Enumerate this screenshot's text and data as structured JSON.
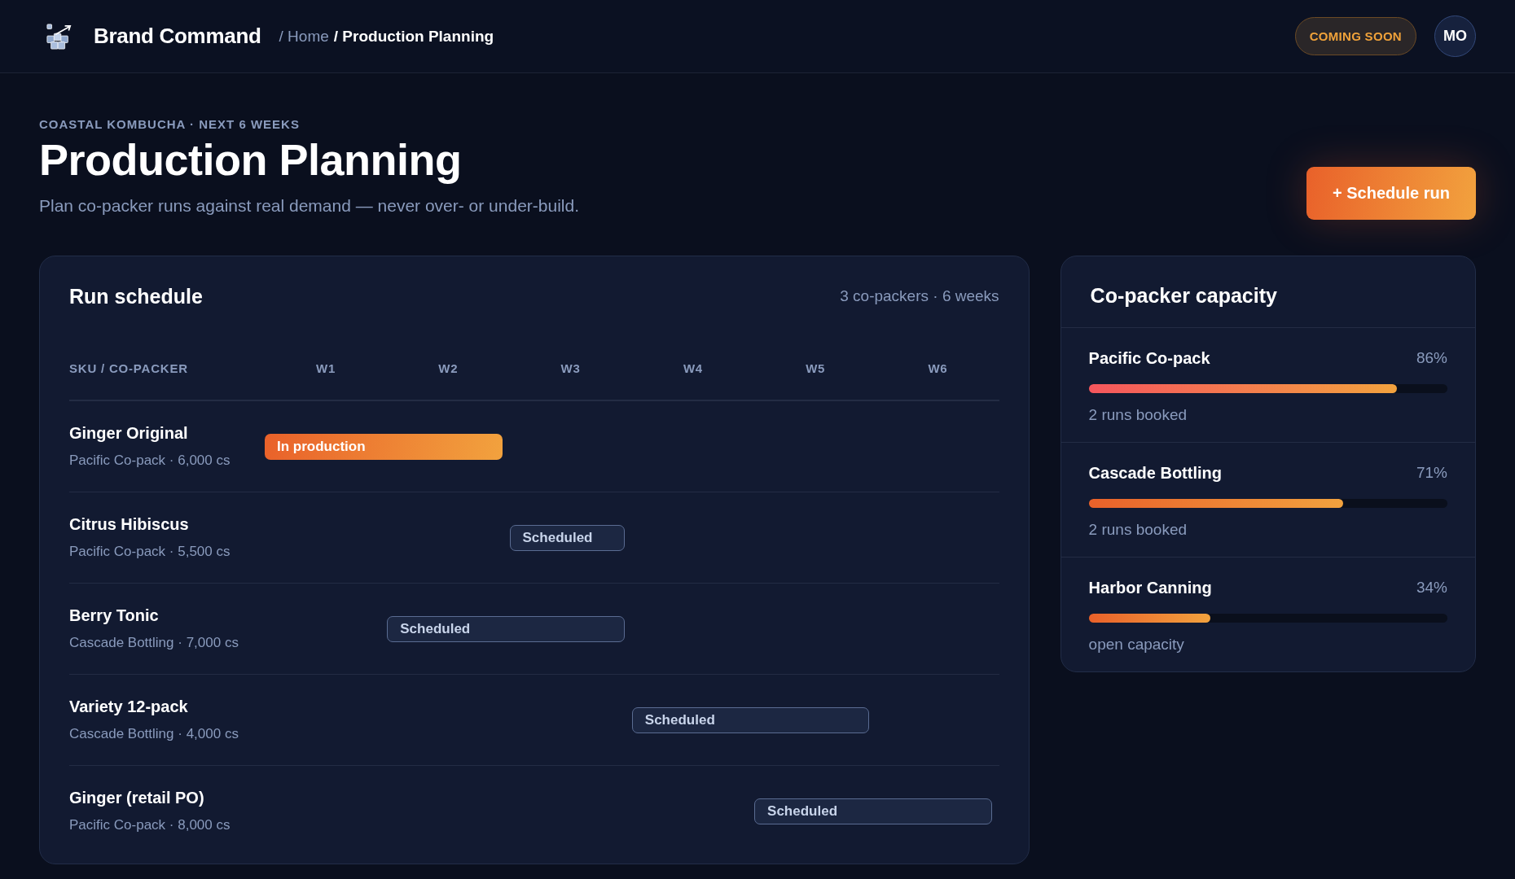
{
  "header": {
    "brand": "Brand Command",
    "breadcrumb": [
      {
        "label": "/ Home",
        "current": false
      },
      {
        "label": "/ Production Planning",
        "current": true
      }
    ],
    "badge": "COMING SOON",
    "avatar": "MO"
  },
  "page": {
    "eyebrow": "COASTAL KOMBUCHA · NEXT 6 WEEKS",
    "title": "Production Planning",
    "subtitle": "Plan co-packer runs against real demand — never over- or under-build.",
    "action": "+ Schedule run"
  },
  "schedule": {
    "title": "Run schedule",
    "summary": "3 co-packers · 6 weeks",
    "columns": [
      "SKU / CO-PACKER",
      "W1",
      "W2",
      "W3",
      "W4",
      "W5",
      "W6"
    ],
    "rows": [
      {
        "sku": "Ginger Original",
        "detail": "Pacific Co-pack · 6,000 cs",
        "run": {
          "label": "In production",
          "kind": "active",
          "weeks": [
            true,
            true,
            false,
            false,
            false,
            false
          ]
        }
      },
      {
        "sku": "Citrus Hibiscus",
        "detail": "Pacific Co-pack · 5,500 cs",
        "run": {
          "label": "Scheduled",
          "kind": "scheduled",
          "weeks": [
            false,
            false,
            true,
            false,
            false,
            false
          ]
        }
      },
      {
        "sku": "Berry Tonic",
        "detail": "Cascade Bottling · 7,000 cs",
        "run": {
          "label": "Scheduled",
          "kind": "scheduled",
          "weeks": [
            false,
            true,
            true,
            false,
            false,
            false
          ]
        }
      },
      {
        "sku": "Variety 12-pack",
        "detail": "Cascade Bottling · 4,000 cs",
        "run": {
          "label": "Scheduled",
          "kind": "scheduled",
          "weeks": [
            false,
            false,
            false,
            true,
            true,
            false
          ]
        }
      },
      {
        "sku": "Ginger (retail PO)",
        "detail": "Pacific Co-pack · 8,000 cs",
        "run": {
          "label": "Scheduled",
          "kind": "scheduled",
          "weeks": [
            false,
            false,
            false,
            false,
            true,
            true
          ]
        }
      }
    ]
  },
  "capacity": {
    "title": "Co-packer capacity",
    "items": [
      {
        "name": "Pacific Co-pack",
        "reading": "86%",
        "level": 0.86,
        "color": "#f5565d",
        "note": "2 runs booked"
      },
      {
        "name": "Cascade Bottling",
        "reading": "71%",
        "level": 0.71,
        "color": "#e9612a",
        "note": "2 runs booked"
      },
      {
        "name": "Harbor Canning",
        "reading": "34%",
        "level": 0.34,
        "color": "#e9612a",
        "note": "open capacity"
      }
    ]
  }
}
